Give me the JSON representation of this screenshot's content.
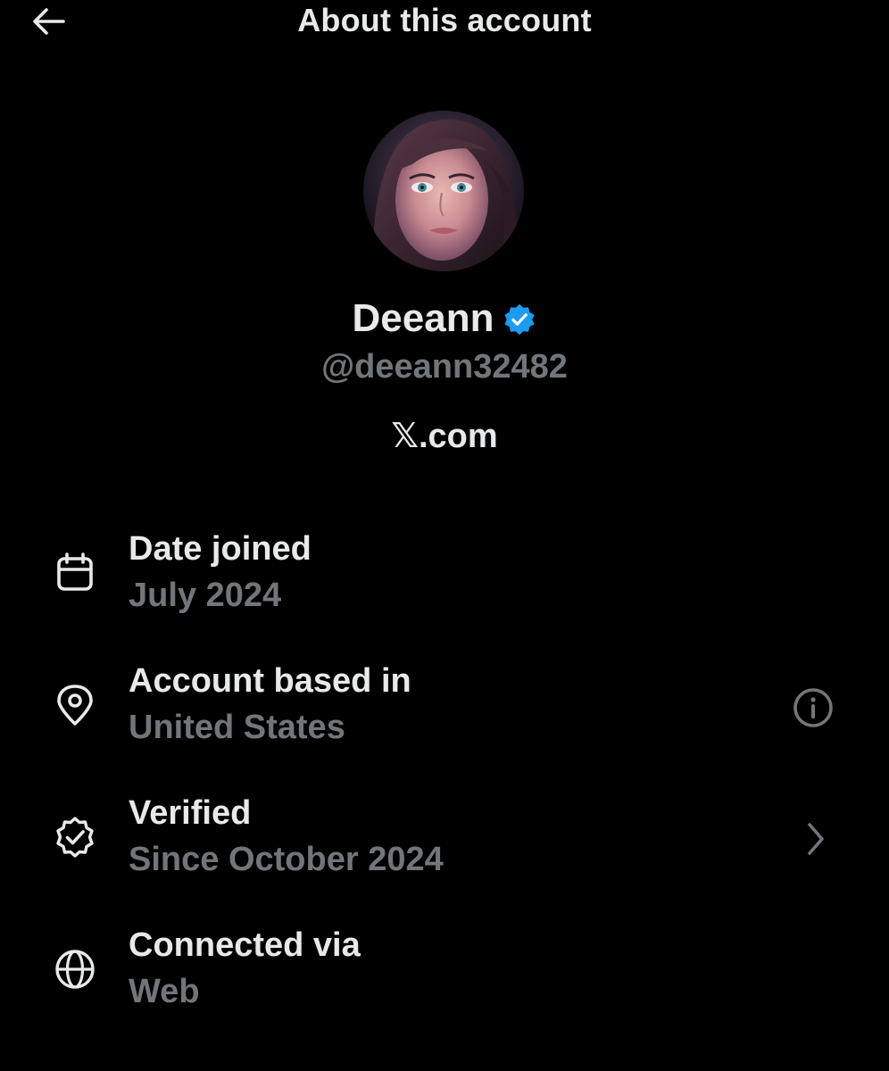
{
  "header": {
    "title": "About this account",
    "back_icon": "arrow-left-icon"
  },
  "profile": {
    "avatar_icon": "avatar-photo",
    "name": "Deeann",
    "verified_icon": "verified-badge-icon",
    "verified_color": "#1d9bf0",
    "handle": "@deeann32482",
    "site_link": "𝕏.com"
  },
  "rows": [
    {
      "icon": "calendar-icon",
      "label": "Date joined",
      "value": "July 2024"
    },
    {
      "icon": "location-pin-icon",
      "label": "Account based in",
      "value": "United States",
      "trailing_icon": "info-icon"
    },
    {
      "icon": "verified-check-icon",
      "label": "Verified",
      "value": "Since October 2024",
      "trailing_icon": "chevron-right-icon"
    },
    {
      "icon": "globe-icon",
      "label": "Connected via",
      "value": "Web"
    }
  ],
  "colors": {
    "background": "#000000",
    "primary_text": "#e7e9ea",
    "secondary_text": "#71767b",
    "accent": "#1d9bf0"
  }
}
